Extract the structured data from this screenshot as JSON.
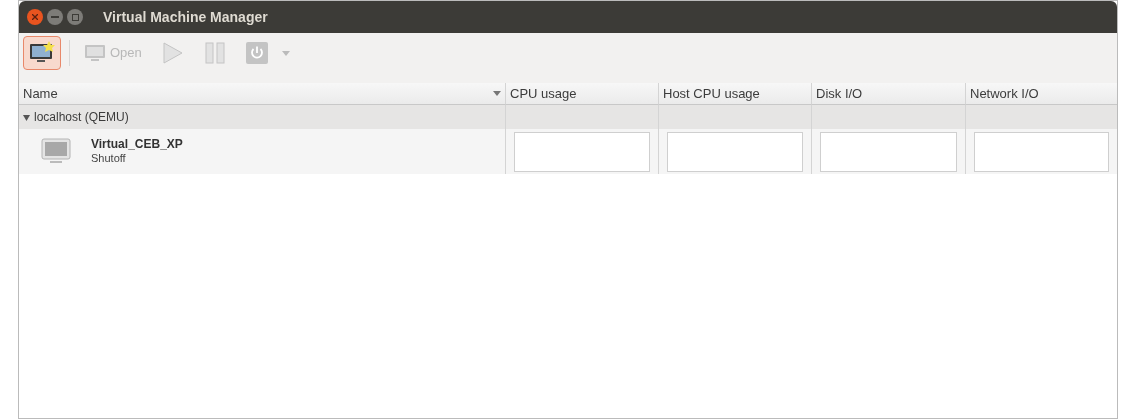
{
  "window": {
    "title": "Virtual Machine Manager"
  },
  "toolbar": [
    {
      "kind": "new",
      "highlighted": true,
      "disabled": false
    },
    {
      "kind": "open",
      "label": "Open",
      "highlighted": false,
      "disabled": true
    },
    {
      "kind": "play",
      "highlighted": false,
      "disabled": true
    },
    {
      "kind": "pause",
      "highlighted": false,
      "disabled": true
    },
    {
      "kind": "power",
      "highlighted": false,
      "disabled": true
    }
  ],
  "table": {
    "columns": [
      "Name",
      "CPU usage",
      "Host CPU usage",
      "Disk I/O",
      "Network I/O"
    ],
    "groups": [
      {
        "label": "localhost (QEMU)",
        "expanded": true,
        "rows": [
          {
            "name": "Virtual_CEB_XP",
            "status": "Shutoff"
          }
        ]
      }
    ]
  }
}
